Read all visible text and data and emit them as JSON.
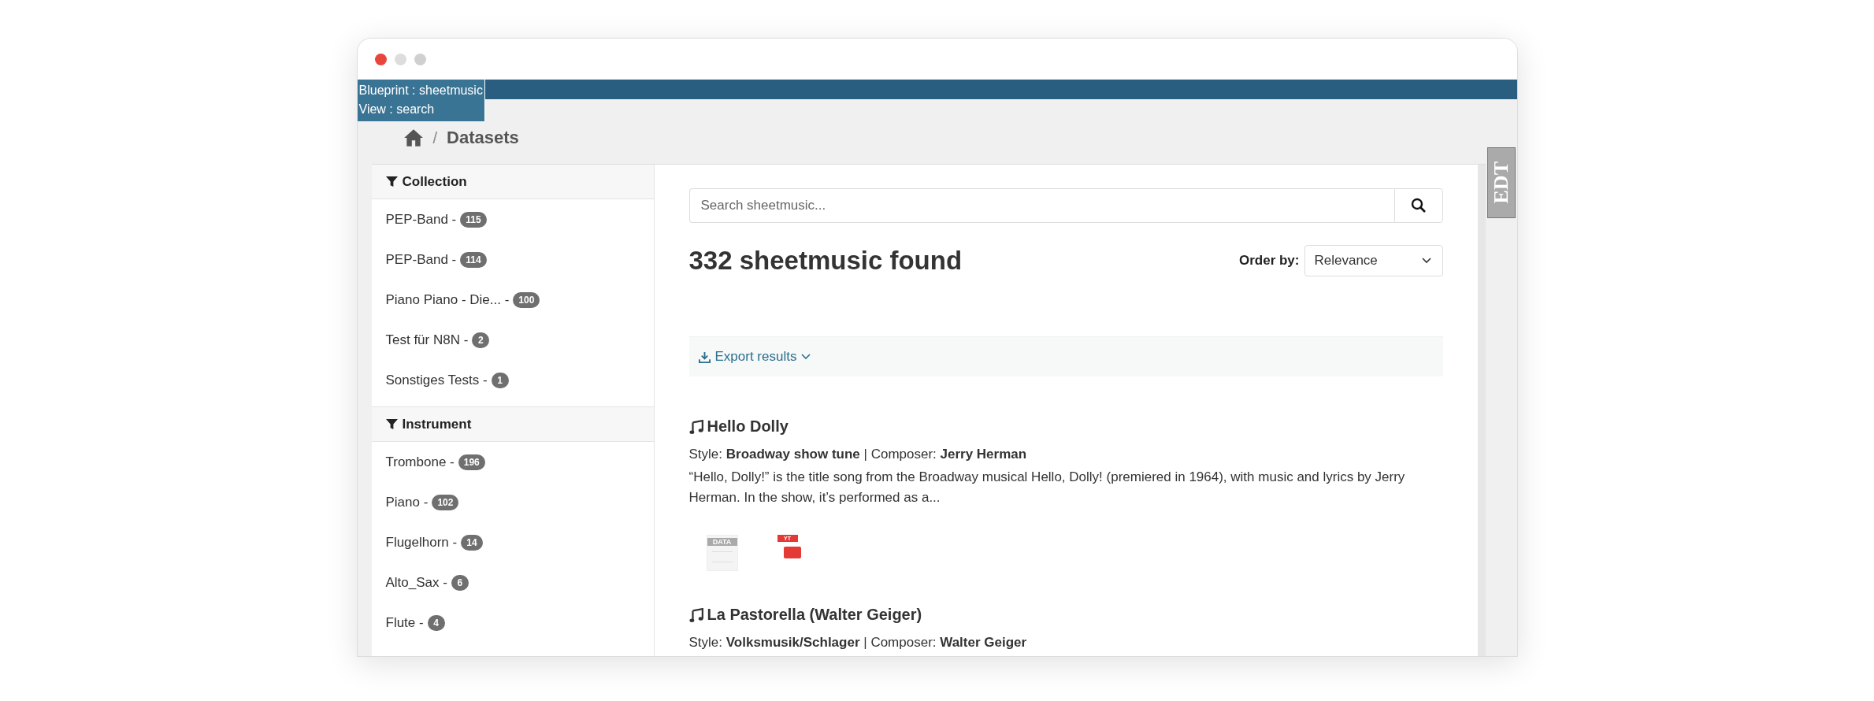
{
  "window": {
    "controls": [
      {
        "color": "#e8463c"
      },
      {
        "color": "#dddddd"
      },
      {
        "color": "#d0d0d0"
      }
    ]
  },
  "debug_label": {
    "blueprint": "Blueprint : sheetmusic",
    "view": "View : search"
  },
  "edit_tab": {
    "label": "EDT"
  },
  "breadcrumb": {
    "separator": "/",
    "current": "Datasets"
  },
  "facets": [
    {
      "title": "Collection",
      "items": [
        {
          "label": "PEP-Band -",
          "count": "115"
        },
        {
          "label": "PEP-Band -",
          "count": "114"
        },
        {
          "label": "Piano Piano - Die... -",
          "count": "100"
        },
        {
          "label": "Test für N8N -",
          "count": "2"
        },
        {
          "label": "Sonstiges Tests -",
          "count": "1"
        }
      ]
    },
    {
      "title": "Instrument",
      "items": [
        {
          "label": "Trombone -",
          "count": "196"
        },
        {
          "label": "Piano -",
          "count": "102"
        },
        {
          "label": "Flugelhorn -",
          "count": "14"
        },
        {
          "label": "Alto_Sax -",
          "count": "6"
        },
        {
          "label": "Flute -",
          "count": "4"
        }
      ]
    }
  ],
  "search": {
    "placeholder": "Search sheetmusic..."
  },
  "results_heading": "332 sheetmusic found",
  "order_by": {
    "label": "Order by:",
    "value": "Relevance"
  },
  "export": {
    "label": "Export results"
  },
  "results": [
    {
      "title": "Hello Dolly",
      "meta": "Style: **Broadway show tune** | Composer: **Jerry Herman**",
      "description": "“Hello, Dolly!” is the title song from the Broadway musical Hello, Dolly! (premiered in 1964), with music and lyrics by Jerry Herman. In the show, it’s performed as a...",
      "files": [
        {
          "kind": "data",
          "label": "DATA"
        },
        {
          "kind": "video",
          "label": "YT"
        }
      ]
    },
    {
      "title": "La Pastorella (Walter Geiger)",
      "meta": "Style: **Volksmusik/Schlager** | Composer: **Walter Geiger**"
    }
  ]
}
